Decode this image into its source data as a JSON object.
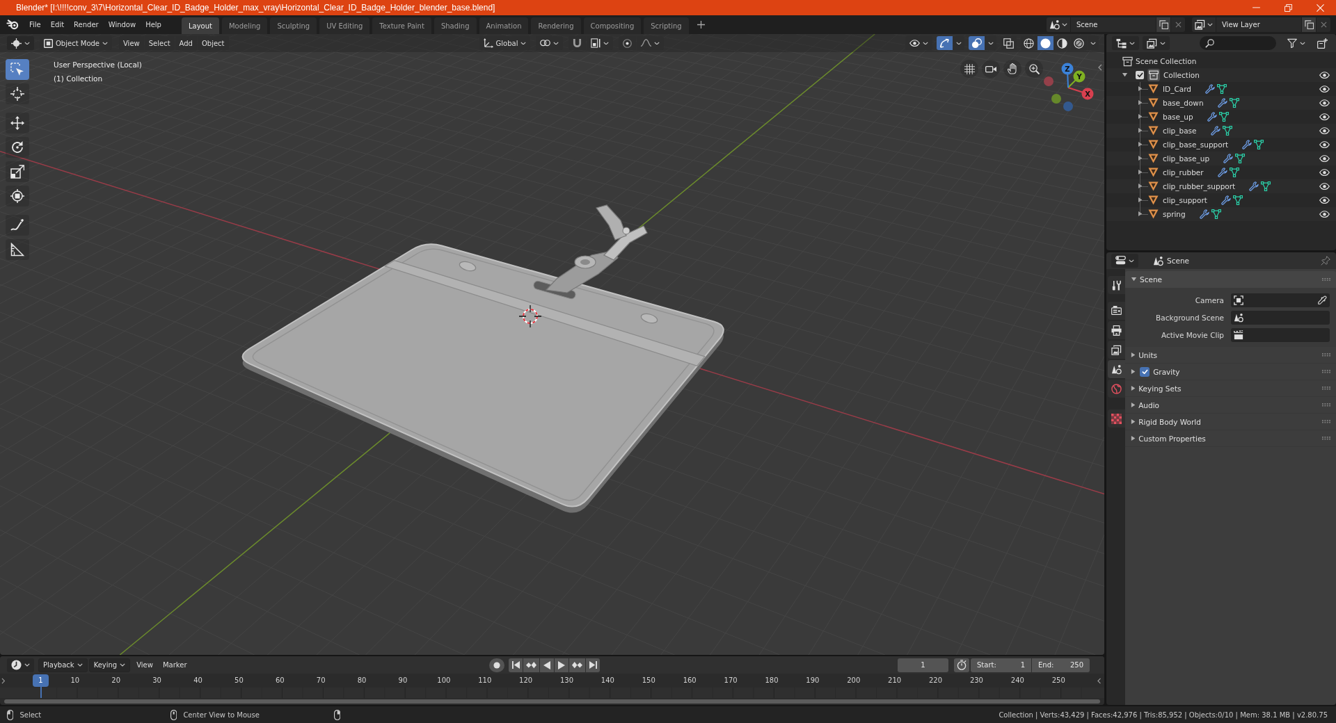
{
  "window": {
    "title": "Blender* [I:\\!!!!conv_3\\7\\Horizontal_Clear_ID_Badge_Holder_max_vray\\Horizontal_Clear_ID_Badge_Holder_blender_base.blend]"
  },
  "menu": [
    "File",
    "Edit",
    "Render",
    "Window",
    "Help"
  ],
  "workspaces": [
    {
      "label": "Layout",
      "selected": true
    },
    {
      "label": "Modeling",
      "selected": false
    },
    {
      "label": "Sculpting",
      "selected": false
    },
    {
      "label": "UV Editing",
      "selected": false
    },
    {
      "label": "Texture Paint",
      "selected": false
    },
    {
      "label": "Shading",
      "selected": false
    },
    {
      "label": "Animation",
      "selected": false
    },
    {
      "label": "Rendering",
      "selected": false
    },
    {
      "label": "Compositing",
      "selected": false
    },
    {
      "label": "Scripting",
      "selected": false
    }
  ],
  "scene": {
    "value": "Scene"
  },
  "view_layer": {
    "value": "View Layer"
  },
  "viewport_header": {
    "mode": "Object Mode",
    "menus": [
      "View",
      "Select",
      "Add",
      "Object"
    ],
    "orientation": "Global",
    "toggles": [
      {
        "kind": "gizmos",
        "on": true
      },
      {
        "kind": "overlays",
        "on": true
      },
      {
        "kind": "xray",
        "on": false
      }
    ],
    "shading": [
      {
        "kind": "wireframe",
        "selected": false
      },
      {
        "kind": "solid",
        "selected": true
      },
      {
        "kind": "material",
        "selected": false
      },
      {
        "kind": "rendered",
        "selected": false
      }
    ]
  },
  "toolbar": [
    [
      {
        "kind": "select",
        "selected": true
      },
      {
        "kind": "cursor",
        "selected": false
      }
    ],
    [
      {
        "kind": "move",
        "selected": false
      },
      {
        "kind": "rotate",
        "selected": false
      },
      {
        "kind": "scale",
        "selected": false
      },
      {
        "kind": "transform",
        "selected": false
      }
    ],
    [
      {
        "kind": "annotate",
        "selected": false
      },
      {
        "kind": "measure",
        "selected": false
      }
    ]
  ],
  "viewport": {
    "view_name": "User Perspective (Local)",
    "collection": "(1) Collection",
    "gizmo_axes": [
      "X",
      "Y",
      "Z"
    ]
  },
  "outliner": {
    "root": "Scene Collection",
    "collection": {
      "name": "Collection",
      "checked": true,
      "expanded": true,
      "children": [
        {
          "name": "ID_Card",
          "expanded": false
        },
        {
          "name": "base_down",
          "expanded": false
        },
        {
          "name": "base_up",
          "expanded": false
        },
        {
          "name": "clip_base",
          "expanded": false
        },
        {
          "name": "clip_base_support",
          "expanded": false
        },
        {
          "name": "clip_base_up",
          "expanded": false
        },
        {
          "name": "clip_rubber",
          "expanded": false
        },
        {
          "name": "clip_rubber_support",
          "expanded": false
        },
        {
          "name": "clip_support",
          "expanded": false
        },
        {
          "name": "spring",
          "expanded": false
        }
      ]
    }
  },
  "properties": {
    "context": "Scene",
    "tabs": [
      [
        {
          "kind": "tool",
          "selected": false
        }
      ],
      [
        {
          "kind": "render",
          "selected": false
        },
        {
          "kind": "output",
          "selected": false
        },
        {
          "kind": "view_layer",
          "selected": false
        },
        {
          "kind": "scene",
          "selected": true
        },
        {
          "kind": "world",
          "selected": false
        }
      ],
      [
        {
          "kind": "texture",
          "selected": false
        }
      ]
    ],
    "panel": {
      "title": "Scene",
      "expanded": true,
      "fields": [
        {
          "label": "Camera",
          "kind": "camera"
        },
        {
          "label": "Background Scene",
          "kind": "scene"
        },
        {
          "label": "Active Movie Clip",
          "kind": "clip"
        }
      ]
    },
    "sections": [
      {
        "title": "Units",
        "kind": "plain",
        "expanded": false
      },
      {
        "title": "Gravity",
        "kind": "checkbox",
        "checked": true,
        "expanded": false
      },
      {
        "title": "Keying Sets",
        "kind": "plain",
        "expanded": false
      },
      {
        "title": "Audio",
        "kind": "plain",
        "expanded": false
      },
      {
        "title": "Rigid Body World",
        "kind": "plain",
        "expanded": false
      },
      {
        "title": "Custom Properties",
        "kind": "plain",
        "expanded": false
      }
    ]
  },
  "timeline": {
    "menus": [
      {
        "label": "Playback",
        "kind": "dropdown"
      },
      {
        "label": "Keying",
        "kind": "dropdown"
      },
      {
        "label": "View",
        "kind": "menu"
      },
      {
        "label": "Marker",
        "kind": "menu"
      }
    ],
    "current_frame": "1",
    "start_label": "Start:",
    "start": "1",
    "end_label": "End:",
    "end": "250",
    "playhead": "1",
    "frame_labels": [
      "10",
      "20",
      "30",
      "40",
      "50",
      "60",
      "70",
      "80",
      "90",
      "100",
      "110",
      "120",
      "130",
      "140",
      "150",
      "160",
      "170",
      "180",
      "190",
      "200",
      "210",
      "220",
      "230",
      "240",
      "250"
    ]
  },
  "status_bar": {
    "hints": [
      {
        "label": "Select"
      },
      {
        "label": "Center View to Mouse"
      }
    ],
    "stats": "Collection | Verts:43,429 | Faces:42,976 | Tris:85,952 | Objects:0/10 | Mem: 38.1 MB | v2.80.75"
  }
}
